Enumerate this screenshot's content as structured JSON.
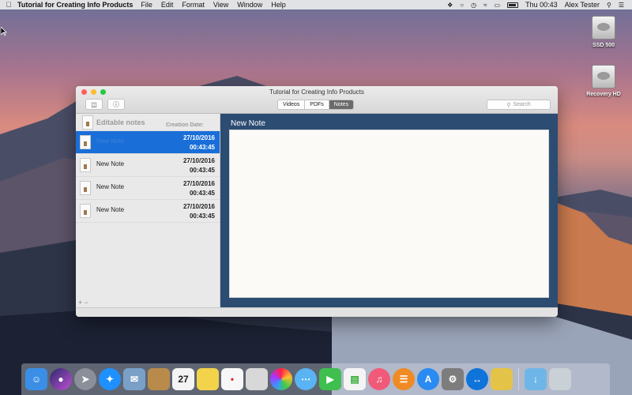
{
  "menubar": {
    "app_name": "Tutorial for Creating Info Products",
    "items": [
      "File",
      "Edit",
      "Format",
      "View",
      "Window",
      "Help"
    ],
    "clock": "Thu 00:43",
    "user": "Alex Tester"
  },
  "desktop": {
    "icons": [
      {
        "label": "SSD 500",
        "icon": "hard-drive-icon"
      },
      {
        "label": "Recovery HD",
        "icon": "hard-drive-icon"
      }
    ]
  },
  "window": {
    "title": "Tutorial for Creating Info Products",
    "tabs": [
      {
        "label": "Videos",
        "active": false
      },
      {
        "label": "PDFs",
        "active": false
      },
      {
        "label": "Notes",
        "active": true
      }
    ],
    "search_placeholder": "Search",
    "sidebar": {
      "title": "Editable notes",
      "date_header": "Creation Date:",
      "notes": [
        {
          "name": "New Note",
          "date": "27/10/2016",
          "time": "00:43:45",
          "selected": true
        },
        {
          "name": "New Note",
          "date": "27/10/2016",
          "time": "00:43:45",
          "selected": false
        },
        {
          "name": "New Note",
          "date": "27/10/2016",
          "time": "00:43:45",
          "selected": false
        },
        {
          "name": "New Note",
          "date": "27/10/2016",
          "time": "00:43:45",
          "selected": false
        }
      ],
      "add_label": "+",
      "remove_label": "−"
    },
    "editor": {
      "title": "New Note",
      "body": ""
    }
  },
  "dock": {
    "apps": [
      {
        "name": "finder-icon",
        "color": "#3a8ee6"
      },
      {
        "name": "siri-icon",
        "color": "#7a3fcf"
      },
      {
        "name": "launchpad-icon",
        "color": "#8a8f99"
      },
      {
        "name": "safari-icon",
        "color": "#1e90ff"
      },
      {
        "name": "mail-icon",
        "color": "#7aa0c8"
      },
      {
        "name": "notes-book-icon",
        "color": "#b88b4a"
      },
      {
        "name": "calendar-icon",
        "color": "#f4f4f4",
        "text": "27"
      },
      {
        "name": "notes-icon",
        "color": "#f3d34a"
      },
      {
        "name": "reminders-icon",
        "color": "#f7f7f7"
      },
      {
        "name": "preview-icon",
        "color": "#d8d8d8"
      },
      {
        "name": "photos-icon",
        "color": "#f29d38"
      },
      {
        "name": "messages-icon",
        "color": "#5ab3f2"
      },
      {
        "name": "facetime-icon",
        "color": "#3fbf4f"
      },
      {
        "name": "numbers-icon",
        "color": "#f4f4f4"
      },
      {
        "name": "itunes-icon",
        "color": "#f05a78"
      },
      {
        "name": "ibooks-icon",
        "color": "#f08a24"
      },
      {
        "name": "app-store-icon",
        "color": "#2a8bf2"
      },
      {
        "name": "system-preferences-icon",
        "color": "#7d7d7d"
      },
      {
        "name": "teamviewer-icon",
        "color": "#0e74d9"
      },
      {
        "name": "info-products-app-icon",
        "color": "#e4c349"
      }
    ],
    "trailing": [
      {
        "name": "downloads-folder-icon",
        "color": "#6fb6e8"
      },
      {
        "name": "trash-icon",
        "color": "#c9d0d6"
      }
    ]
  }
}
